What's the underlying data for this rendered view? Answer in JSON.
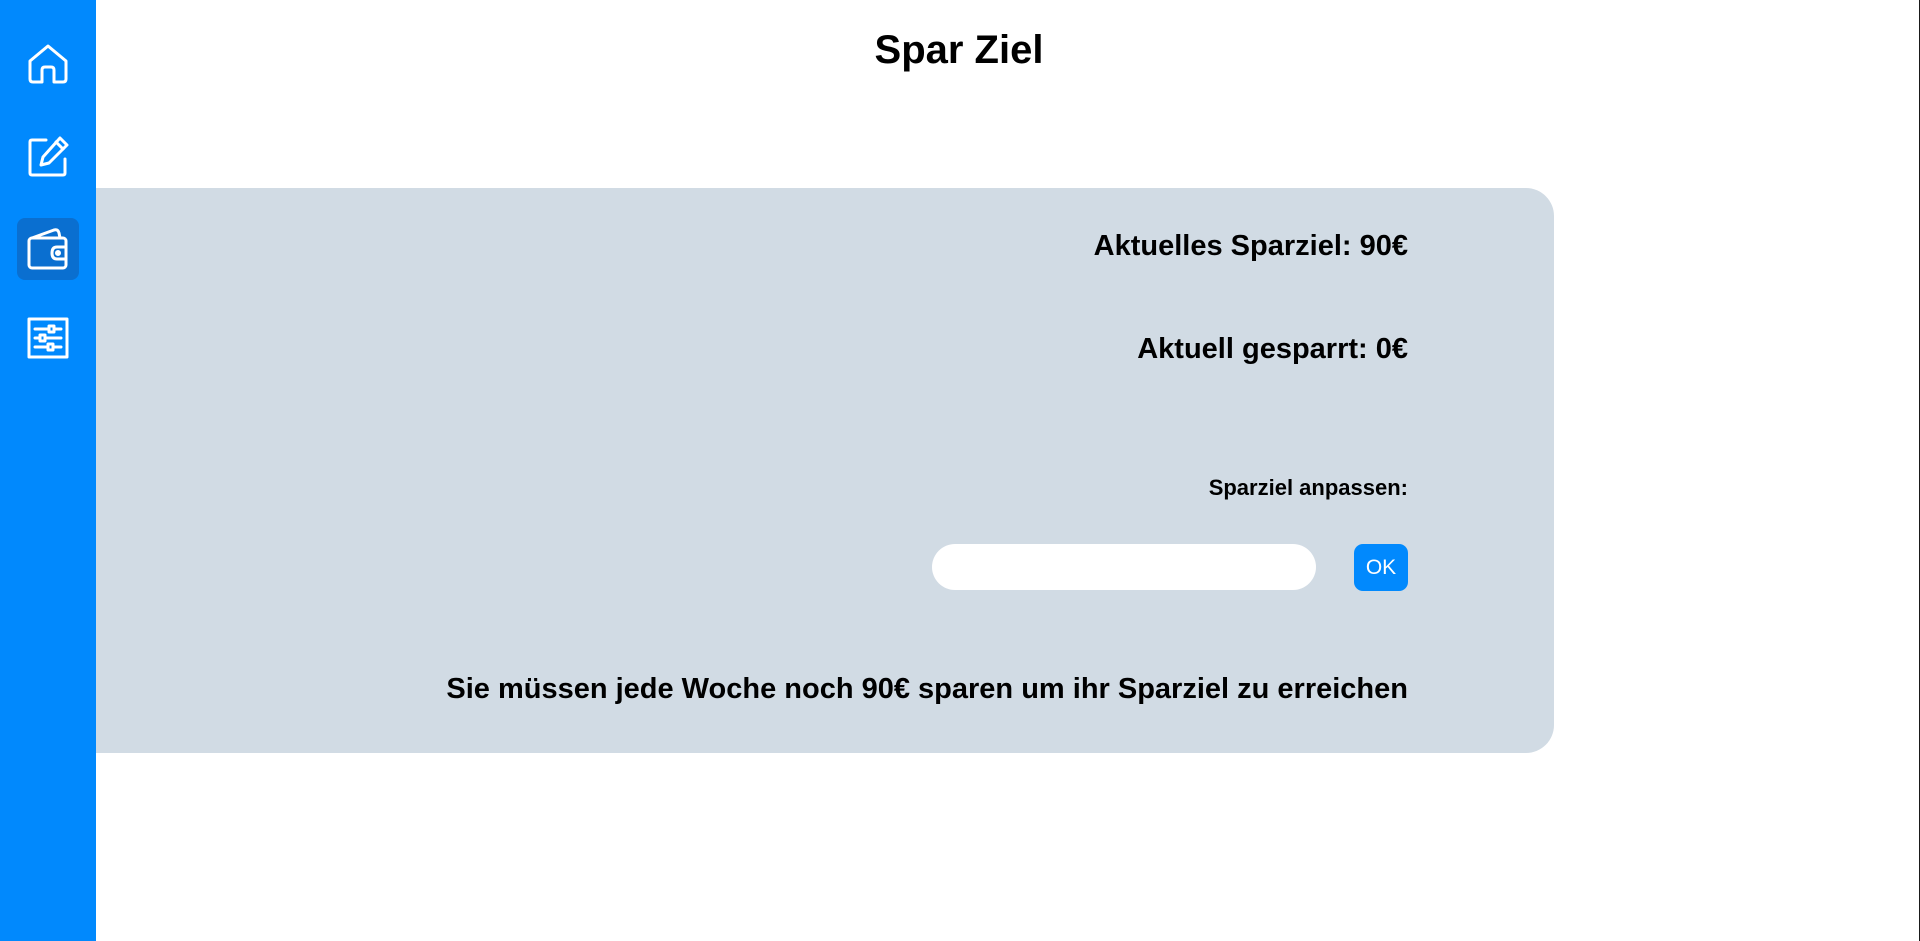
{
  "page": {
    "title": "Spar Ziel"
  },
  "sidebar": {
    "items": [
      {
        "icon": "home-icon",
        "active": false
      },
      {
        "icon": "edit-icon",
        "active": false
      },
      {
        "icon": "wallet-icon",
        "active": true
      },
      {
        "icon": "sliders-icon",
        "active": false
      }
    ]
  },
  "card": {
    "goal_text": "Aktuelles Sparziel: 90€",
    "saved_text": "Aktuell gesparrt: 0€",
    "adjust_label": "Sparziel anpassen:",
    "goal_input_value": "",
    "goal_input_placeholder": "",
    "ok_label": "OK",
    "weekly_text": "Sie müssen jede Woche noch 90€ sparen um ihr Sparziel zu erreichen"
  },
  "colors": {
    "sidebar": "#0189fd",
    "active_nav": "#0a6fd0",
    "card": "#d1dbe4",
    "button": "#0189fd",
    "text": "#000000"
  }
}
